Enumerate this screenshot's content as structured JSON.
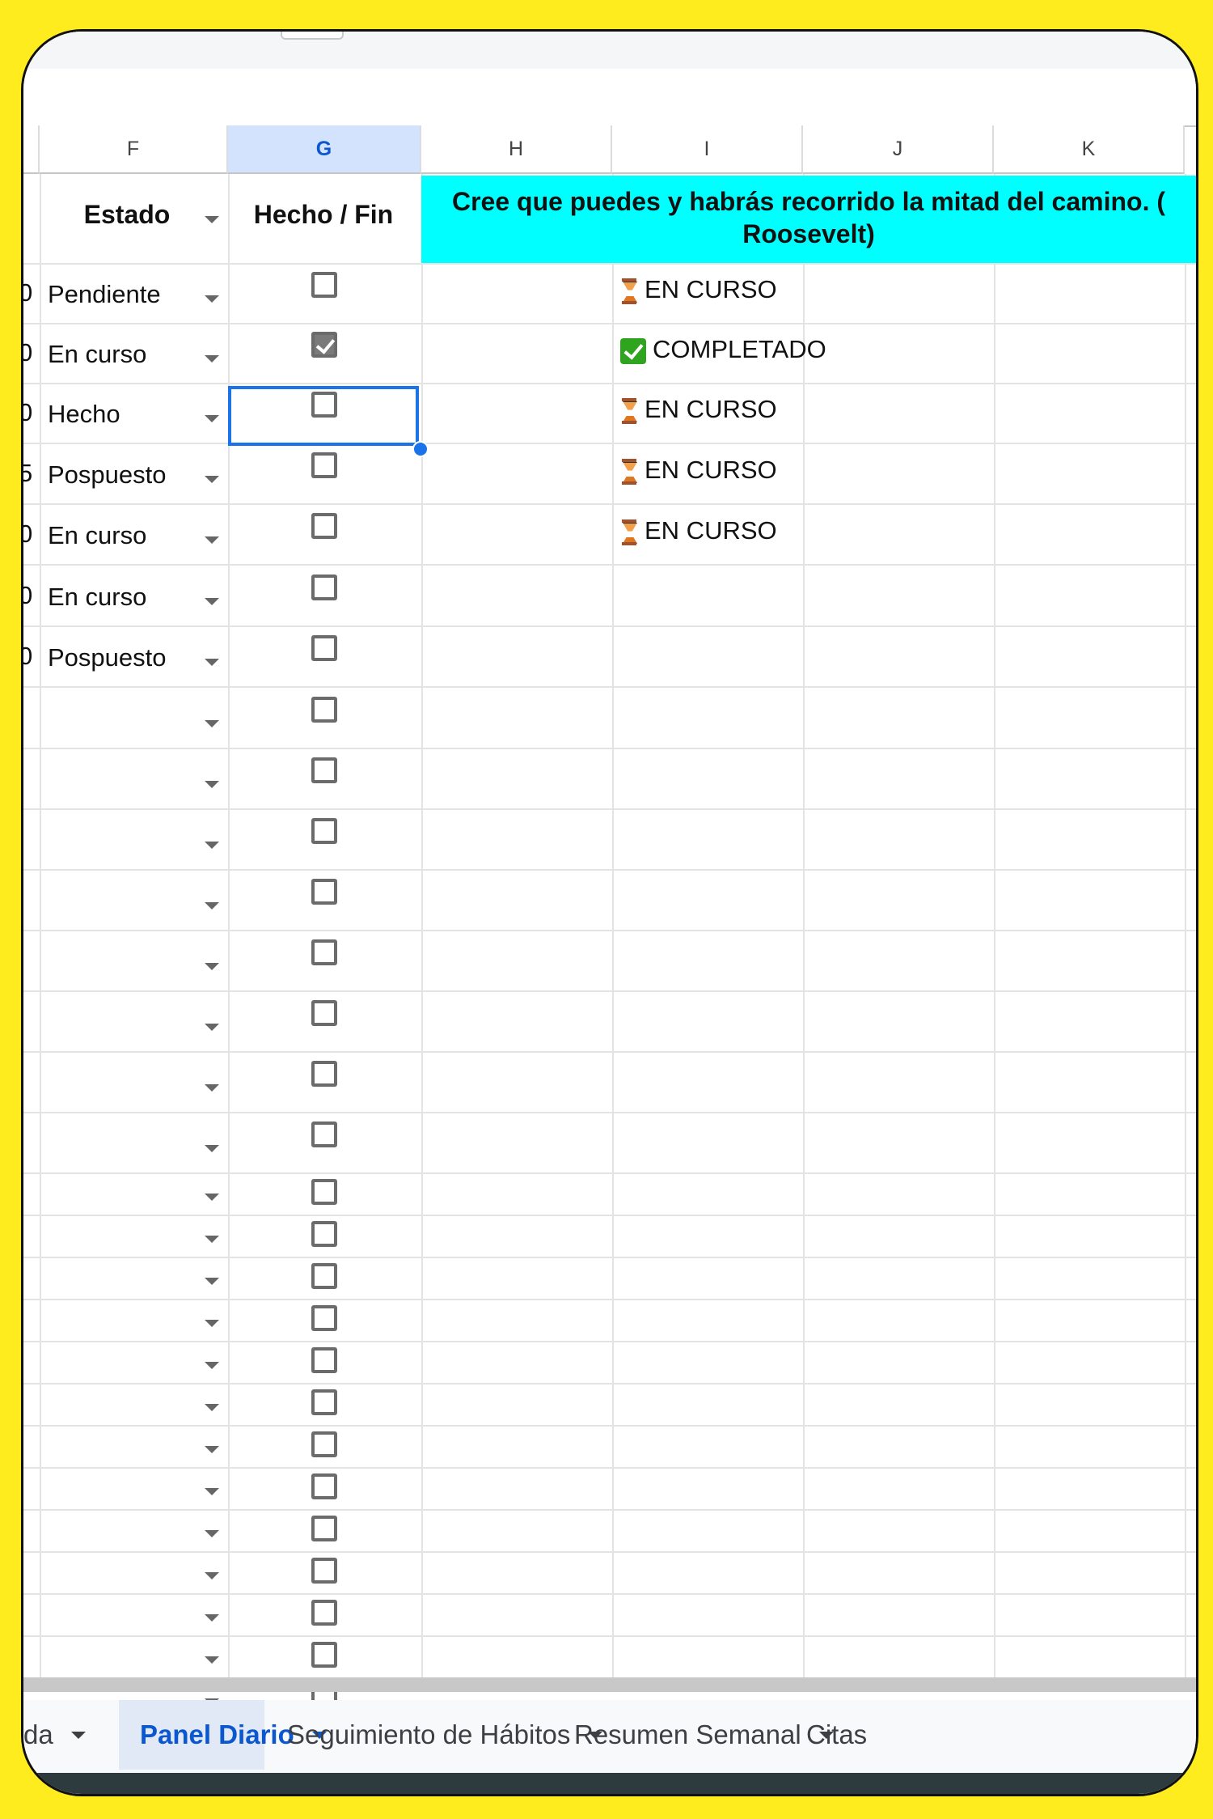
{
  "columns": [
    "F",
    "G",
    "H",
    "I",
    "J",
    "K"
  ],
  "header": {
    "estado": "Estado",
    "hecho": "Hecho / Fin",
    "quote_line1": "Cree que puedes y habrás recorrido la mitad del camino.  (",
    "quote_line2": "Roosevelt)"
  },
  "rows": [
    {
      "lead": "0",
      "estado": "Pendiente",
      "checked": false,
      "status": "EN CURSO",
      "status_icon": "hourglass-icon"
    },
    {
      "lead": "0",
      "estado": "En curso",
      "checked": true,
      "status": "COMPLETADO",
      "status_icon": "check-mark-icon"
    },
    {
      "lead": "0",
      "estado": "Hecho",
      "checked": false,
      "status": "EN CURSO",
      "status_icon": "hourglass-icon"
    },
    {
      "lead": "5",
      "estado": "Pospuesto",
      "checked": false,
      "status": "EN CURSO",
      "status_icon": "hourglass-icon"
    },
    {
      "lead": "0",
      "estado": "En curso",
      "checked": false,
      "status": "EN CURSO",
      "status_icon": "hourglass-icon"
    },
    {
      "lead": "0",
      "estado": "En curso",
      "checked": false,
      "status": "",
      "status_icon": ""
    },
    {
      "lead": "0",
      "estado": "Pospuesto",
      "checked": false,
      "status": "",
      "status_icon": ""
    }
  ],
  "empty_row_count": 24,
  "tabs": [
    {
      "label": "da",
      "active": false,
      "has_menu": true
    },
    {
      "label": "Panel Diario",
      "active": true,
      "has_menu": true
    },
    {
      "label": "Seguimiento de Hábitos",
      "active": false,
      "has_menu": true
    },
    {
      "label": "Resumen Semanal",
      "active": false,
      "has_menu": true
    },
    {
      "label": "Citas",
      "active": false,
      "has_menu": false
    }
  ],
  "colors": {
    "accent": "#1a73e8",
    "quote_bg": "#00ffff",
    "frame_bg": "#ffec1f"
  }
}
